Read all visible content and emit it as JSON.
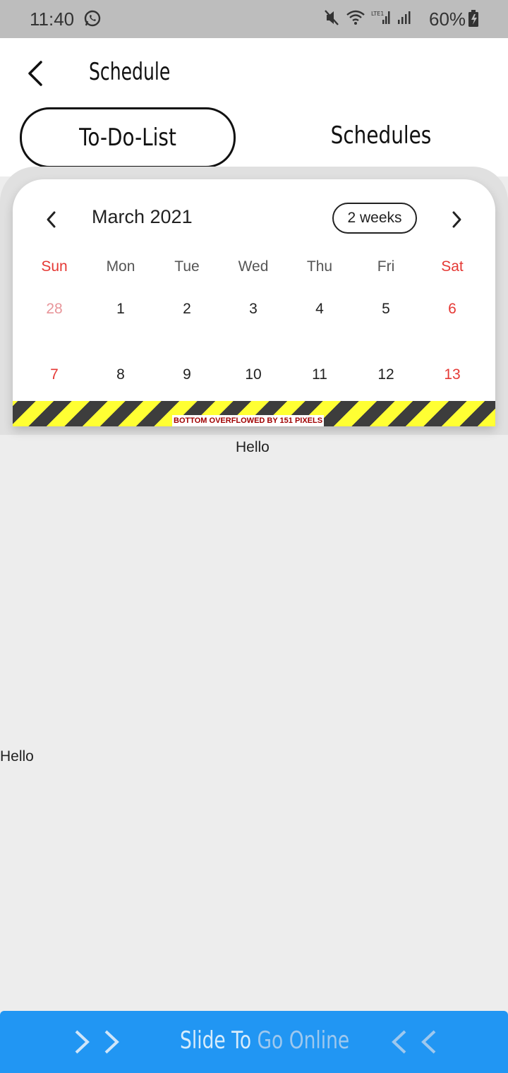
{
  "status_bar": {
    "time": "11:40",
    "battery": "60%"
  },
  "app_bar": {
    "title": "Schedule"
  },
  "tabs": [
    {
      "label": "To-Do-List",
      "active": true
    },
    {
      "label": "Schedules",
      "active": false
    }
  ],
  "calendar": {
    "month_label": "March 2021",
    "format_button": "2 weeks",
    "weekdays": [
      "Sun",
      "Mon",
      "Tue",
      "Wed",
      "Thu",
      "Fri",
      "Sat"
    ],
    "weeks": [
      [
        "28",
        "1",
        "2",
        "3",
        "4",
        "5",
        "6"
      ],
      [
        "7",
        "8",
        "9",
        "10",
        "11",
        "12",
        "13"
      ]
    ],
    "overflow_warning": "BOTTOM OVERFLOWED BY 151 PIXELS"
  },
  "content": {
    "hello_centered": "Hello",
    "hello_left": "Hello"
  },
  "slide_button": {
    "label_part1": "Slide To ",
    "label_part2": "Go Online"
  },
  "colors": {
    "accent_blue": "#2196f3",
    "weekend_red": "#e53935",
    "overflow_yellow": "#ffff33"
  }
}
